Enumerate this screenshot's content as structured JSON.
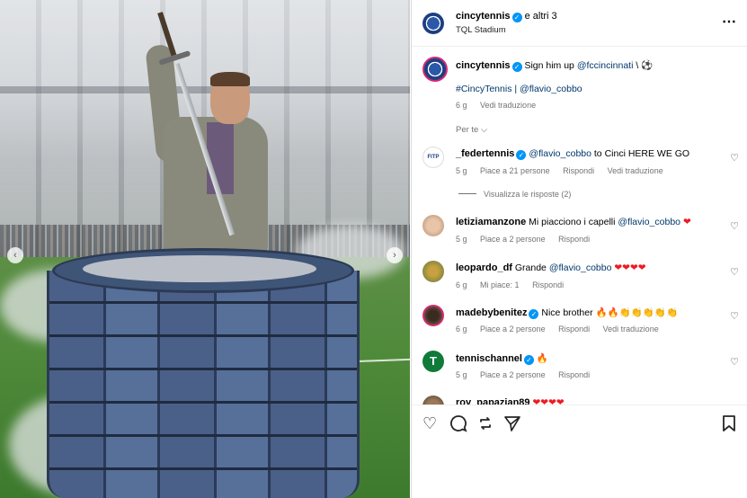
{
  "header": {
    "username": "cincytennis",
    "coauthors": "e altri 3",
    "location": "TQL Stadium",
    "more_icon": "more-icon"
  },
  "caption": {
    "username": "cincytennis",
    "text": "Sign him up",
    "mention": "@fccincinnati",
    "suffix": "\\ ⚽",
    "hashtag": "#CincyTennis",
    "separator": "|",
    "mention2": "@flavio_cobbo",
    "age": "6 g",
    "translate": "Vedi traduzione"
  },
  "sort": {
    "label": "Per te"
  },
  "comments": [
    {
      "username": "_federtennis",
      "verified": true,
      "mention": "@flavio_cobbo",
      "text": "to Cinci HERE WE GO",
      "age": "5 g",
      "likes": "Piace a 21 persone",
      "reply": "Rispondi",
      "translate": "Vedi traduzione",
      "view_replies": "Visualizza le risposte (2)"
    },
    {
      "username": "letiziamanzone",
      "verified": false,
      "text": "Mi piacciono i capelli",
      "mention": "@flavio_cobbo",
      "emoji": "❤",
      "age": "5 g",
      "likes": "Piace a 2 persone",
      "reply": "Rispondi"
    },
    {
      "username": "leopardo_df",
      "verified": false,
      "text": "Grande",
      "mention": "@flavio_cobbo",
      "emoji": "❤❤❤❤",
      "age": "6 g",
      "likes": "Mi piace: 1",
      "reply": "Rispondi"
    },
    {
      "username": "madebybenitez",
      "verified": true,
      "text": "Nice brother 🔥🔥👏👏👏👏👏",
      "age": "6 g",
      "likes": "Piace a 2 persone",
      "reply": "Rispondi",
      "translate": "Vedi traduzione"
    },
    {
      "username": "tennischannel",
      "verified": true,
      "text": "🔥",
      "age": "5 g",
      "likes": "Piace a 2 persone",
      "reply": "Rispondi"
    },
    {
      "username": "roy_papazian89",
      "verified": false,
      "text": "❤❤❤❤"
    }
  ],
  "colors": {
    "link": "#00376b",
    "verified": "#0095f6",
    "meta": "#737373",
    "heart": "#ed1b24"
  }
}
